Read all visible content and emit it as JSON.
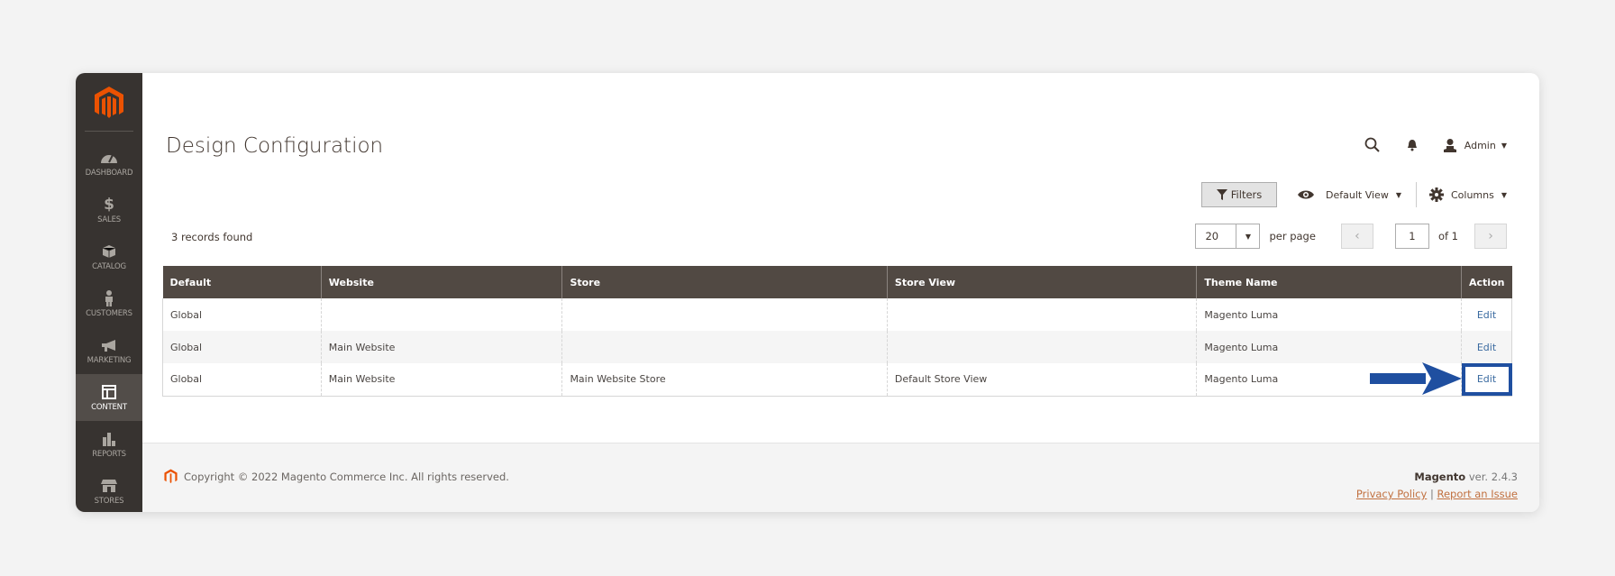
{
  "sidebar": {
    "items": [
      {
        "label": "DASHBOARD",
        "icon": "dashboard-icon"
      },
      {
        "label": "SALES",
        "icon": "dollar-icon"
      },
      {
        "label": "CATALOG",
        "icon": "box-icon"
      },
      {
        "label": "CUSTOMERS",
        "icon": "person-icon"
      },
      {
        "label": "MARKETING",
        "icon": "megaphone-icon"
      },
      {
        "label": "CONTENT",
        "icon": "layout-icon",
        "active": true
      },
      {
        "label": "REPORTS",
        "icon": "bar-chart-icon"
      },
      {
        "label": "STORES",
        "icon": "storefront-icon"
      }
    ]
  },
  "header": {
    "title": "Design Configuration",
    "user": "Admin"
  },
  "toolbar": {
    "filters_label": "Filters",
    "view_label": "Default View",
    "columns_label": "Columns"
  },
  "grid": {
    "records_found": "3 records found",
    "per_page_value": "20",
    "per_page_label": "per page",
    "current_page": "1",
    "page_of": "of 1",
    "columns": [
      "Default",
      "Website",
      "Store",
      "Store View",
      "Theme Name",
      "Action"
    ],
    "rows": [
      [
        "Global",
        "",
        "",
        "",
        "Magento Luma",
        "Edit"
      ],
      [
        "Global",
        "Main Website",
        "",
        "",
        "Magento Luma",
        "Edit"
      ],
      [
        "Global",
        "Main Website",
        "Main Website Store",
        "Default Store View",
        "Magento Luma",
        "Edit"
      ]
    ]
  },
  "annotation": {
    "highlight_color": "#1f4fa0"
  },
  "footer": {
    "copyright": "Copyright © 2022 Magento Commerce Inc. All rights reserved.",
    "brand": "Magento",
    "version": "ver. 2.4.3",
    "privacy": "Privacy Policy",
    "separator": "|",
    "report": "Report an Issue"
  },
  "colors": {
    "brand_orange": "#eb5202",
    "sidebar_bg": "#373330",
    "header_bg": "#514943",
    "link": "#3a6aa0"
  }
}
